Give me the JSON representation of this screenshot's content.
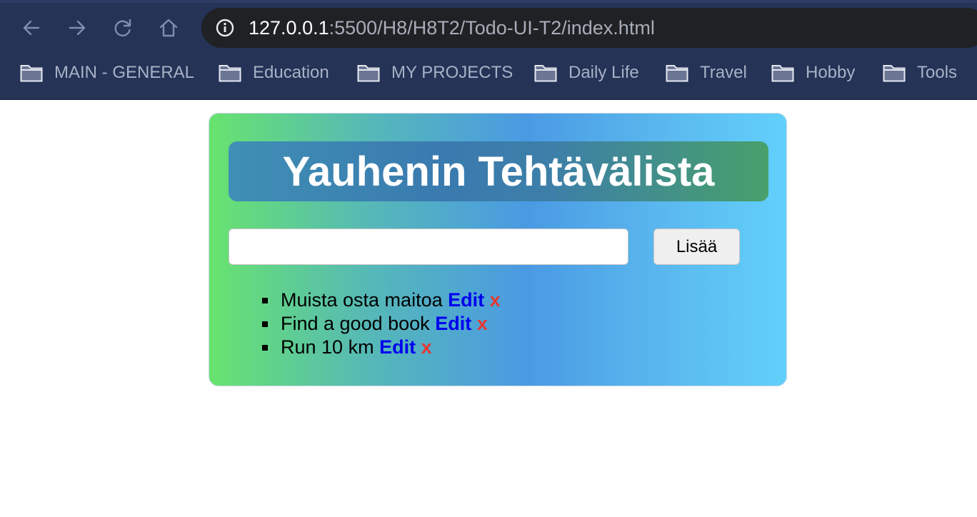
{
  "browser": {
    "url_host": "127.0.0.1",
    "url_rest": ":5500/H8/H8T2/Todo-UI-T2/index.html",
    "bookmarks": [
      {
        "label": "MAIN - GENERAL",
        "icon": "folder-icon"
      },
      {
        "label": "Education",
        "icon": "folder-icon"
      },
      {
        "label": "MY PROJECTS",
        "icon": "folder-icon"
      },
      {
        "label": "Daily Life",
        "icon": "folder-icon"
      },
      {
        "label": "Travel",
        "icon": "folder-icon"
      },
      {
        "label": "Hobby",
        "icon": "folder-icon"
      },
      {
        "label": "Tools",
        "icon": "folder-icon"
      }
    ]
  },
  "app": {
    "title": "Yauhenin Tehtävälista",
    "input_value": "",
    "add_label": "Lisää",
    "todos": [
      {
        "text": "Muista osta maitoa",
        "edit": "Edit",
        "delete": "x"
      },
      {
        "text": "Find a good book",
        "edit": "Edit",
        "delete": "x"
      },
      {
        "text": "Run 10 km",
        "edit": "Edit",
        "delete": "x"
      }
    ]
  },
  "colors": {
    "chrome_bg": "#243356",
    "urlbar_bg": "#202124",
    "edit_link": "#0000ee",
    "delete_link": "#e53935"
  }
}
